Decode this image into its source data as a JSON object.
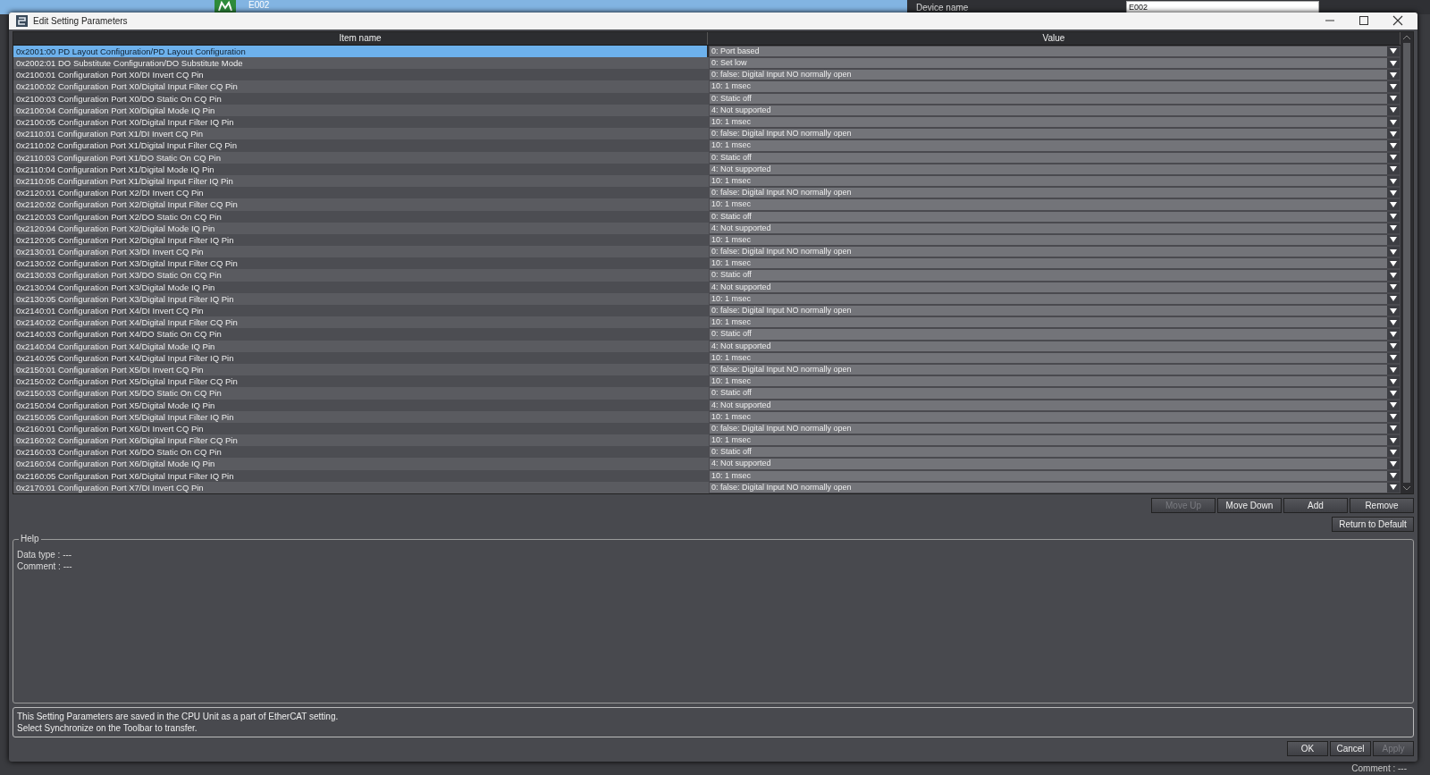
{
  "background_app": {
    "node_label": "E002",
    "device_label": "Device name",
    "device_value": "E002",
    "comment": "Comment : ---"
  },
  "window": {
    "title": "Edit Setting Parameters"
  },
  "table": {
    "columns": [
      "Item name",
      "Value"
    ],
    "rows": [
      {
        "item": "0x2001:00 PD Layout Configuration/PD Layout Configuration",
        "value": "0: Port based",
        "selected": true
      },
      {
        "item": "0x2002:01 DO Substitute Configuration/DO Substitute Mode",
        "value": "0: Set low",
        "selected": false
      },
      {
        "item": "0x2100:01 Configuration Port X0/DI Invert CQ Pin",
        "value": "0: false: Digital Input NO normally open",
        "selected": false
      },
      {
        "item": "0x2100:02 Configuration Port X0/Digital Input Filter CQ Pin",
        "value": "10: 1 msec",
        "selected": false
      },
      {
        "item": "0x2100:03 Configuration Port X0/DO Static On CQ Pin",
        "value": "0: Static off",
        "selected": false
      },
      {
        "item": "0x2100:04 Configuration Port X0/Digital Mode IQ Pin",
        "value": "4: Not supported",
        "selected": false
      },
      {
        "item": "0x2100:05 Configuration Port X0/Digital Input Filter IQ Pin",
        "value": "10: 1 msec",
        "selected": false
      },
      {
        "item": "0x2110:01 Configuration Port X1/DI Invert CQ Pin",
        "value": "0: false: Digital Input NO normally open",
        "selected": false
      },
      {
        "item": "0x2110:02 Configuration Port X1/Digital Input Filter CQ Pin",
        "value": "10: 1 msec",
        "selected": false
      },
      {
        "item": "0x2110:03 Configuration Port X1/DO Static On CQ Pin",
        "value": "0: Static off",
        "selected": false
      },
      {
        "item": "0x2110:04 Configuration Port X1/Digital Mode IQ Pin",
        "value": "4: Not supported",
        "selected": false
      },
      {
        "item": "0x2110:05 Configuration Port X1/Digital Input Filter IQ Pin",
        "value": "10: 1 msec",
        "selected": false
      },
      {
        "item": "0x2120:01 Configuration Port X2/DI Invert CQ Pin",
        "value": "0: false: Digital Input NO normally open",
        "selected": false
      },
      {
        "item": "0x2120:02 Configuration Port X2/Digital Input Filter CQ Pin",
        "value": "10: 1 msec",
        "selected": false
      },
      {
        "item": "0x2120:03 Configuration Port X2/DO Static On CQ Pin",
        "value": "0: Static off",
        "selected": false
      },
      {
        "item": "0x2120:04 Configuration Port X2/Digital Mode IQ Pin",
        "value": "4: Not supported",
        "selected": false
      },
      {
        "item": "0x2120:05 Configuration Port X2/Digital Input Filter IQ Pin",
        "value": "10: 1 msec",
        "selected": false
      },
      {
        "item": "0x2130:01 Configuration Port X3/DI Invert CQ Pin",
        "value": "0: false: Digital Input NO normally open",
        "selected": false
      },
      {
        "item": "0x2130:02 Configuration Port X3/Digital Input Filter CQ Pin",
        "value": "10: 1 msec",
        "selected": false
      },
      {
        "item": "0x2130:03 Configuration Port X3/DO Static On CQ Pin",
        "value": "0: Static off",
        "selected": false
      },
      {
        "item": "0x2130:04 Configuration Port X3/Digital Mode IQ Pin",
        "value": "4: Not supported",
        "selected": false
      },
      {
        "item": "0x2130:05 Configuration Port X3/Digital Input Filter IQ Pin",
        "value": "10: 1 msec",
        "selected": false
      },
      {
        "item": "0x2140:01 Configuration Port X4/DI Invert CQ Pin",
        "value": "0: false: Digital Input NO normally open",
        "selected": false
      },
      {
        "item": "0x2140:02 Configuration Port X4/Digital Input Filter CQ Pin",
        "value": "10: 1 msec",
        "selected": false
      },
      {
        "item": "0x2140:03 Configuration Port X4/DO Static On CQ Pin",
        "value": "0: Static off",
        "selected": false
      },
      {
        "item": "0x2140:04 Configuration Port X4/Digital Mode IQ Pin",
        "value": "4: Not supported",
        "selected": false
      },
      {
        "item": "0x2140:05 Configuration Port X4/Digital Input Filter IQ Pin",
        "value": "10: 1 msec",
        "selected": false
      },
      {
        "item": "0x2150:01 Configuration Port X5/DI Invert CQ Pin",
        "value": "0: false: Digital Input NO normally open",
        "selected": false
      },
      {
        "item": "0x2150:02 Configuration Port X5/Digital Input Filter CQ Pin",
        "value": "10: 1 msec",
        "selected": false
      },
      {
        "item": "0x2150:03 Configuration Port X5/DO Static On CQ Pin",
        "value": "0: Static off",
        "selected": false
      },
      {
        "item": "0x2150:04 Configuration Port X5/Digital Mode IQ Pin",
        "value": "4: Not supported",
        "selected": false
      },
      {
        "item": "0x2150:05 Configuration Port X5/Digital Input Filter IQ Pin",
        "value": "10: 1 msec",
        "selected": false
      },
      {
        "item": "0x2160:01 Configuration Port X6/DI Invert CQ Pin",
        "value": "0: false: Digital Input NO normally open",
        "selected": false
      },
      {
        "item": "0x2160:02 Configuration Port X6/Digital Input Filter CQ Pin",
        "value": "10: 1 msec",
        "selected": false
      },
      {
        "item": "0x2160:03 Configuration Port X6/DO Static On CQ Pin",
        "value": "0: Static off",
        "selected": false
      },
      {
        "item": "0x2160:04 Configuration Port X6/Digital Mode IQ Pin",
        "value": "4: Not supported",
        "selected": false
      },
      {
        "item": "0x2160:05 Configuration Port X6/Digital Input Filter IQ Pin",
        "value": "10: 1 msec",
        "selected": false
      },
      {
        "item": "0x2170:01 Configuration Port X7/DI Invert CQ Pin",
        "value": "0: false: Digital Input NO normally open",
        "selected": false
      }
    ]
  },
  "list_buttons": [
    {
      "label": "Move Up",
      "disabled": true
    },
    {
      "label": "Move Down",
      "disabled": false
    },
    {
      "label": "Add",
      "disabled": false
    },
    {
      "label": "Remove",
      "disabled": false
    }
  ],
  "default_button": {
    "label": "Return to Default",
    "disabled": false
  },
  "help": {
    "title": "Help",
    "lines": [
      "Data type : ---",
      "Comment : ---"
    ]
  },
  "note": [
    "This Setting Parameters are saved in the CPU Unit as a part of EtherCAT setting.",
    "Select Synchronize on the Toolbar to transfer."
  ],
  "dialog_buttons": [
    {
      "label": "OK",
      "disabled": false
    },
    {
      "label": "Cancel",
      "disabled": false
    },
    {
      "label": "Apply",
      "disabled": true
    }
  ]
}
